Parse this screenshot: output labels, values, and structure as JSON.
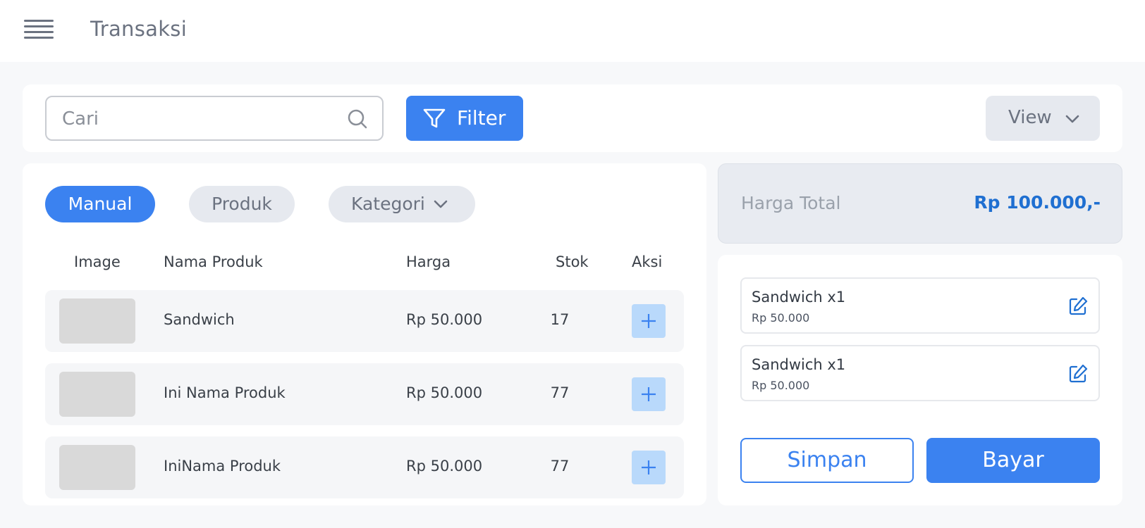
{
  "header": {
    "title": "Transaksi",
    "menu_icon": "hamburger-menu-icon"
  },
  "toolbar": {
    "search": {
      "placeholder": "Cari",
      "value": "",
      "icon": "search-icon"
    },
    "filter_label": "Filter",
    "filter_icon": "filter-funnel-icon",
    "view_label": "View",
    "view_icon": "chevron-down-icon"
  },
  "tabs": {
    "manual": "Manual",
    "produk": "Produk",
    "kategori": "Kategori",
    "active": "Manual"
  },
  "table": {
    "headers": [
      "Image",
      "Nama Produk",
      "Harga",
      "Stok",
      "Aksi"
    ],
    "rows": [
      {
        "name": "Sandwich",
        "price": "Rp 50.000",
        "stock": "17"
      },
      {
        "name": "Ini Nama Produk",
        "price": "Rp 50.000",
        "stock": "77"
      },
      {
        "name": "IniNama Produk",
        "price": "Rp 50.000",
        "stock": "77"
      }
    ]
  },
  "summary": {
    "total_label": "Harga Total",
    "total_value": "Rp 100.000,-"
  },
  "cart": {
    "items": [
      {
        "name": "Sandwich x1",
        "price": "Rp 50.000"
      },
      {
        "name": "Sandwich x1",
        "price": "Rp 50.000"
      }
    ],
    "save_label": "Simpan",
    "pay_label": "Bayar"
  },
  "colors": {
    "primary": "#3b82f0",
    "total_value": "#1f6fd1",
    "add_button_bg": "#b9d9fb",
    "page_bg": "#f7f8fa"
  }
}
